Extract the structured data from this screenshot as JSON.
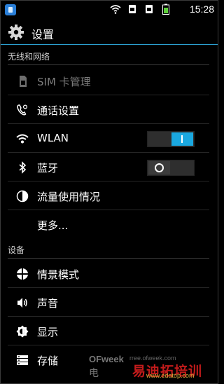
{
  "status_bar": {
    "time": "15:28"
  },
  "header": {
    "title": "设置",
    "accent": "#2b9fd0"
  },
  "sections": {
    "wireless": "无线和网络",
    "device": "设备"
  },
  "items": {
    "sim": "SIM 卡管理",
    "call": "通话设置",
    "wlan": "WLAN",
    "bluetooth": "蓝牙",
    "data_usage": "流量使用情况",
    "more": "更多...",
    "profiles": "情景模式",
    "sound": "声音",
    "display": "显示",
    "storage": "存储"
  },
  "toggles": {
    "wlan": "on",
    "bluetooth": "off",
    "on_color": "#1aa8e0"
  },
  "watermark": {
    "brand": "OFweek",
    "url": "rree.ofweek.com",
    "site_cn": "易迪拓培训",
    "prefix": "电",
    "url2": "www.edatop.com"
  }
}
